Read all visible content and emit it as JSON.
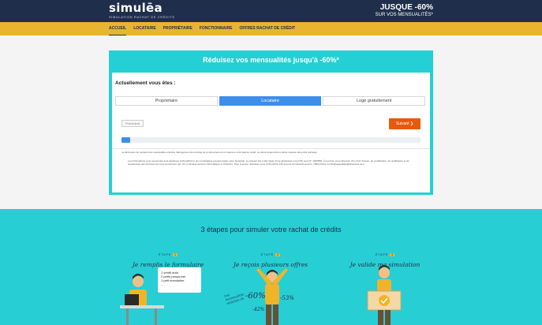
{
  "header": {
    "logo": "simulēa",
    "logo_tagline": "SIMULATION RACHAT DE CRÉDITS",
    "promo_main": "JUSQUE -60%",
    "promo_sub": "SUR VOS MENSUALITÉS*"
  },
  "nav": {
    "items": [
      "ACCUEIL",
      "LOCATAIRE",
      "PROPRIÉTAIRE",
      "FONCTIONNAIRE",
      "OFFRES RACHAT DE CRÉDIT"
    ]
  },
  "simulator": {
    "title": "Réduisez vos mensualités jusqu'à -60%*",
    "question": "Actuellement vous êtes :",
    "options": [
      "Propriétaire",
      "Locataire",
      "Logé gratuitement"
    ],
    "selected_option": "Locataire",
    "prev_label": "Précédent",
    "next_label": "Suivant ❯",
    "progress": 0.03,
    "legal_1": "La diminution du montant des mensualités entraîne l'allongement de la durée de remboursement et majore le coût total du crédit. La durée dépend de la durée restante des prêts rachetés.",
    "legal_2": "Les informations vous concernant sont destinées à DirectPrêt et aux prestataires pouvant traiter votre demande. Le présent site a fait l'objet d'une déclaration à la CNIL sous N° 1957859. À tout titre, vous disposez d'un droit d'accès, de modification, de rectification et de suppression des données qui vous concernent (art. 34 et suivants de la loi 'Informatique et Libertés'). Pour l'exercer, adressez-vous à DirectPrêt 132 avenue du Général Leclerc, 75014 Paris ou info@aegeallias@directpret.com"
  },
  "steps": {
    "title": "3 étapes pour simuler votre rachat de crédits",
    "items": [
      {
        "tag": "ÉTAPE",
        "number": "1",
        "title": "Je remplis le formulaire"
      },
      {
        "tag": "ÉTAPE",
        "number": "2",
        "title": "Je reçois plusieurs offres"
      },
      {
        "tag": "ÉTAPE",
        "number": "3",
        "title": "Je valide ma simulation"
      }
    ],
    "bubble_lines": [
      "1 crédit auto",
      "2 prêts personnel",
      "1 prêt immobilier",
      "..."
    ],
    "offers_caption": "vos mensualités réduites de",
    "percent_big": "-60%",
    "percent_mid": "-53%",
    "percent_small": "-42%"
  },
  "colors": {
    "navy": "#1f2e4a",
    "gold": "#e9b430",
    "turquoise": "#24d0d4",
    "blue": "#3d8ee8",
    "orange": "#e8590c"
  }
}
